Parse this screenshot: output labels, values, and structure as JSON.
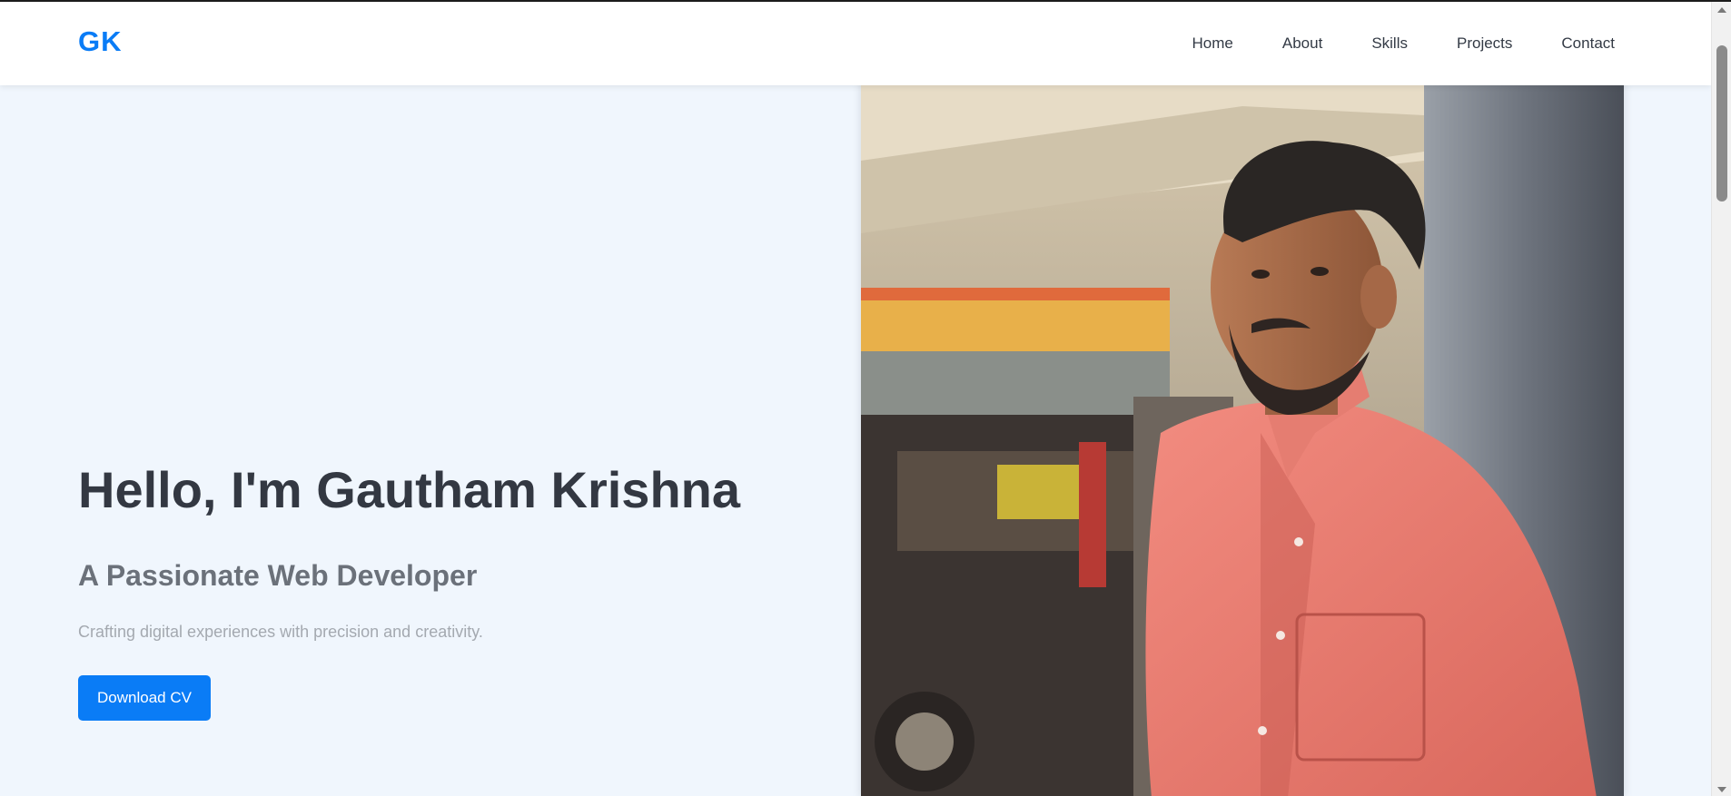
{
  "header": {
    "logo": "GK",
    "nav": {
      "home": "Home",
      "about": "About",
      "skills": "Skills",
      "projects": "Projects",
      "contact": "Contact"
    }
  },
  "hero": {
    "title": "Hello, I'm Gautham Krishna",
    "subtitle": "A Passionate Web Developer",
    "tagline": "Crafting digital experiences with precision and creativity.",
    "button_label": "Download CV"
  },
  "colors": {
    "accent": "#0a7cf6",
    "background": "#f0f6fd",
    "heading": "#333842",
    "subheading": "#6b717a",
    "muted": "#a4a9b0"
  }
}
